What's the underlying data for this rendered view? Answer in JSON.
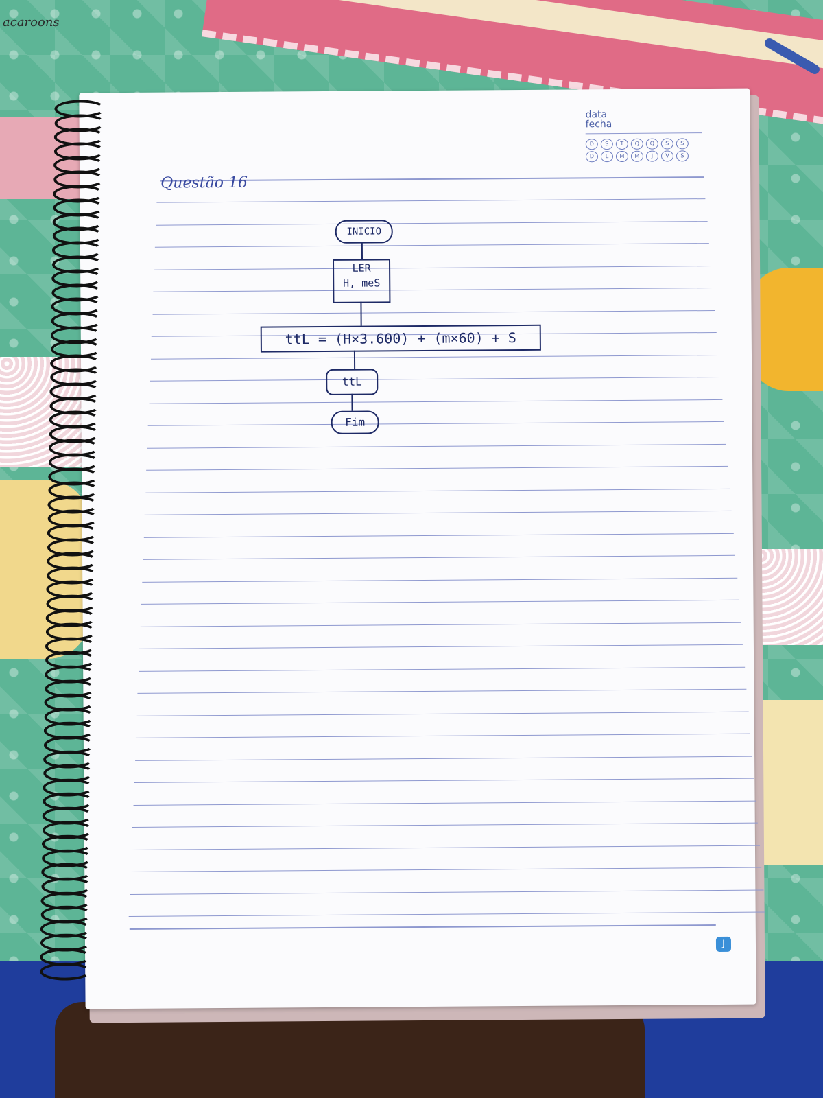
{
  "cover": {
    "logo_text": "acaroons"
  },
  "page": {
    "date_label_pt": "data",
    "date_label_es": "fecha",
    "weekday_row_1": [
      "D",
      "S",
      "T",
      "Q",
      "Q",
      "S",
      "S"
    ],
    "weekday_row_2": [
      "D",
      "L",
      "M",
      "M",
      "J",
      "V",
      "S"
    ],
    "heading": "Questão 16"
  },
  "flowchart": {
    "start": "INICIO",
    "input_line1": "LER",
    "input_line2": "H, meS",
    "process": "ttL = (H×3.600) + (m×60) + S",
    "output": "ttL",
    "end": "Fim"
  },
  "badge": "J"
}
